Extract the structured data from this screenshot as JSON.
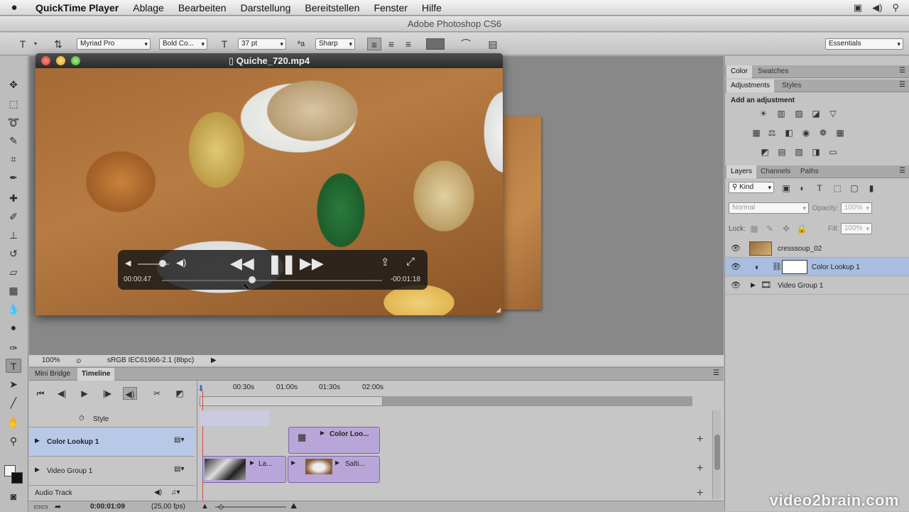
{
  "menubar": {
    "apple": "",
    "app": "QuickTime Player",
    "items": [
      "Ablage",
      "Bearbeiten",
      "Darstellung",
      "Bereitstellen",
      "Fenster",
      "Hilfe"
    ],
    "status_icons": [
      "display-icon",
      "volume-icon",
      "search-icon"
    ]
  },
  "photoshop": {
    "title": "Adobe Photoshop CS6",
    "options": {
      "font_family": "Myriad Pro",
      "font_style": "Bold Co...",
      "font_size": "37 pt",
      "aa_label": "ªa",
      "antialias": "Sharp",
      "workspace": "Essentials"
    },
    "status": {
      "zoom": "100%",
      "profile": "sRGB IEC61966-2.1 (8bpc)"
    }
  },
  "quicktime": {
    "title": "Quiche_720.mp4",
    "elapsed": "00:00:47",
    "remaining": "-00:01:18",
    "progress": 0.41,
    "volume": 0.8
  },
  "panels": {
    "top_tabs": [
      "Color",
      "Swatches"
    ],
    "adj_tabs": [
      "Adjustments",
      "Styles"
    ],
    "add_adjustment": "Add an adjustment",
    "layer_tabs": [
      "Layers",
      "Channels",
      "Paths"
    ],
    "kind": "Kind",
    "blend_mode": "Normal",
    "opacity_label": "Opacity:",
    "opacity_value": "100%",
    "lock_label": "Lock:",
    "fill_label": "Fill:",
    "fill_value": "100%",
    "layers": [
      {
        "name": "cresssoup_02"
      },
      {
        "name": "Color Lookup 1"
      },
      {
        "name": "Video Group 1"
      }
    ]
  },
  "timeline": {
    "tabs": [
      "Mini Bridge",
      "Timeline"
    ],
    "ruler": [
      "00:30s",
      "01:00s",
      "01:30s",
      "02:00s"
    ],
    "style_label": "Style",
    "tracks": [
      "Color Lookup 1",
      "Video Group 1",
      "Audio Track"
    ],
    "clips": {
      "color_lookup": "Color Loo...",
      "video_a": "La...",
      "video_b": "Salti..."
    },
    "timecode": "0:00:01:09",
    "fps": "(25,00 fps)"
  },
  "watermark": "video2brain.com"
}
